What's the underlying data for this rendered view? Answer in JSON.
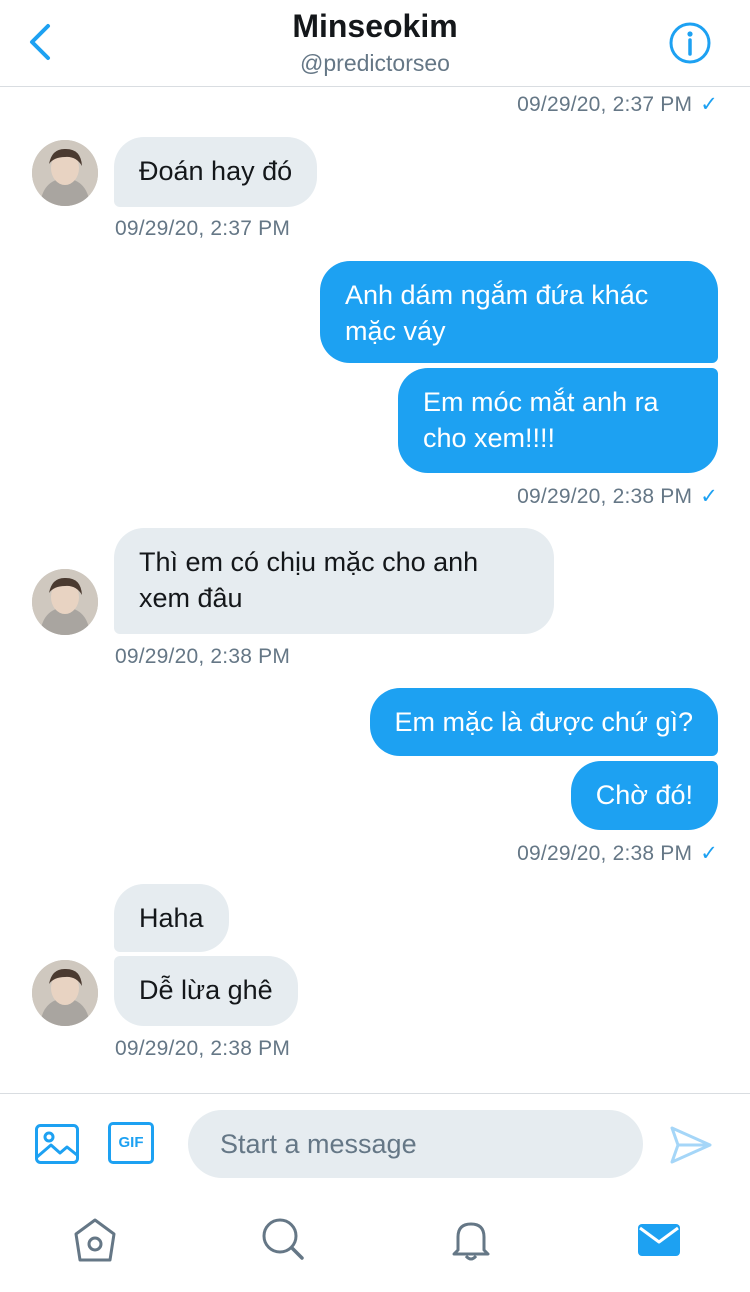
{
  "header": {
    "title": "Minseokim",
    "handle": "@predictorseo"
  },
  "messages": [
    {
      "direction": "out",
      "timestamp": "09/29/20, 2:37 PM",
      "delivered": true
    },
    {
      "direction": "in",
      "text": [
        "Đoán hay đó"
      ],
      "timestamp": "09/29/20, 2:37 PM"
    },
    {
      "direction": "out",
      "text": [
        "Anh dám ngắm đứa khác mặc váy",
        "Em móc mắt anh ra cho xem!!!!"
      ],
      "timestamp": "09/29/20, 2:38 PM",
      "delivered": true
    },
    {
      "direction": "in",
      "text": [
        "Thì em có chịu mặc cho anh xem đâu"
      ],
      "timestamp": "09/29/20, 2:38 PM"
    },
    {
      "direction": "out",
      "text": [
        "Em mặc là được chứ gì?",
        "Chờ đó!"
      ],
      "timestamp": "09/29/20, 2:38 PM",
      "delivered": true
    },
    {
      "direction": "in",
      "text": [
        "Haha",
        "Dễ lừa ghê"
      ],
      "timestamp": "09/29/20, 2:38 PM"
    }
  ],
  "bubbles": {
    "in1": "Đoán hay đó",
    "out1_l1": "Anh dám ngắm đứa khác",
    "out1_l2": "mặc váy",
    "out2_l1": "Em móc mắt anh ra",
    "out2_l2": "cho xem!!!!",
    "in2_l1": "Thì em có chịu mặc cho anh",
    "in2_l2": "xem đâu",
    "out3": "Em mặc là được chứ gì?",
    "out4": "Chờ đó!",
    "in3": "Haha",
    "in4": "Dễ lừa ghê"
  },
  "timestamps": {
    "t0": "09/29/20, 2:37 PM",
    "t1": "09/29/20, 2:37 PM",
    "t2": "09/29/20, 2:38 PM",
    "t3": "09/29/20, 2:38 PM",
    "t4": "09/29/20, 2:38 PM",
    "t5": "09/29/20, 2:38 PM"
  },
  "read_check": "✓",
  "composer": {
    "placeholder": "Start a message",
    "gif_label": "GIF"
  },
  "tabs": [
    "home",
    "search",
    "notifications",
    "messages"
  ],
  "colors": {
    "accent": "#1da1f2",
    "incoming_bubble": "#e6ecf0",
    "secondary_text": "#657786",
    "active_tab": "#1da1f2",
    "inactive_tab": "#657786"
  },
  "icons": {
    "back": "chevron-left-icon",
    "info": "info-icon",
    "media": "image-icon",
    "send": "send-icon",
    "home": "home-icon",
    "search": "search-icon",
    "notifications": "bell-icon",
    "messages": "mail-icon"
  }
}
